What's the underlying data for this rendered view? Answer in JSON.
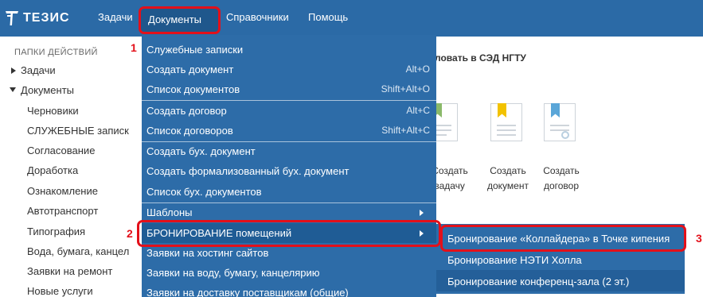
{
  "topbar": {
    "logo_text": "ТЕЗИС",
    "nav": [
      {
        "label": "Задачи"
      },
      {
        "label": "Документы"
      },
      {
        "label": "Справочники"
      },
      {
        "label": "Помощь"
      }
    ]
  },
  "sidebar": {
    "heading": "ПАПКИ ДЕЙСТВИЙ",
    "items": [
      {
        "label": "Задачи"
      },
      {
        "label": "Документы"
      },
      {
        "label": "Черновики"
      },
      {
        "label": "СЛУЖЕБНЫЕ записк"
      },
      {
        "label": "Согласование"
      },
      {
        "label": "Доработка"
      },
      {
        "label": "Ознакомление"
      },
      {
        "label": "Автотранспорт"
      },
      {
        "label": "Типография"
      },
      {
        "label": "Вода, бумага, канцел"
      },
      {
        "label": "Заявки на ремонт"
      },
      {
        "label": "Новые услуги"
      }
    ]
  },
  "main": {
    "welcome": "ловать в СЭД НГТУ",
    "quick_actions": [
      {
        "line1": "Создать",
        "line2": "задачу",
        "icon": "task-icon",
        "color": "#8ab96a"
      },
      {
        "line1": "Создать",
        "line2": "документ",
        "icon": "document-icon",
        "color": "#f2c200"
      },
      {
        "line1": "Создать",
        "line2": "договор",
        "icon": "contract-icon",
        "color": "#5aa6d8"
      }
    ]
  },
  "menu": {
    "items": [
      {
        "label": "Служебные записки",
        "shortcut": ""
      },
      {
        "label": "Создать документ",
        "shortcut": "Alt+O"
      },
      {
        "label": "Список документов",
        "shortcut": "Shift+Alt+O"
      },
      {
        "label": "Создать договор",
        "shortcut": "Alt+C"
      },
      {
        "label": "Список договоров",
        "shortcut": "Shift+Alt+C"
      },
      {
        "label": "Создать бух. документ",
        "shortcut": ""
      },
      {
        "label": "Создать формализованный бух. документ",
        "shortcut": ""
      },
      {
        "label": "Список бух. документов",
        "shortcut": ""
      },
      {
        "label": "Шаблоны",
        "shortcut": ""
      },
      {
        "label": "БРОНИРОВАНИЕ помещений",
        "shortcut": ""
      },
      {
        "label": "Заявки на хостинг сайтов",
        "shortcut": ""
      },
      {
        "label": "Заявки на воду, бумагу, канцелярию",
        "shortcut": ""
      },
      {
        "label": "Заявки на доставку поставщикам (общие)",
        "shortcut": ""
      }
    ]
  },
  "submenu": {
    "items": [
      {
        "label": "Бронирование «Коллайдера» в Точке кипения"
      },
      {
        "label": "Бронирование НЭТИ Холла"
      },
      {
        "label": "Бронирование конференц-зала (2 эт.)"
      }
    ]
  },
  "annotations": {
    "step1": "1",
    "step2": "2",
    "step3": "3",
    "color": "#e3101a"
  }
}
